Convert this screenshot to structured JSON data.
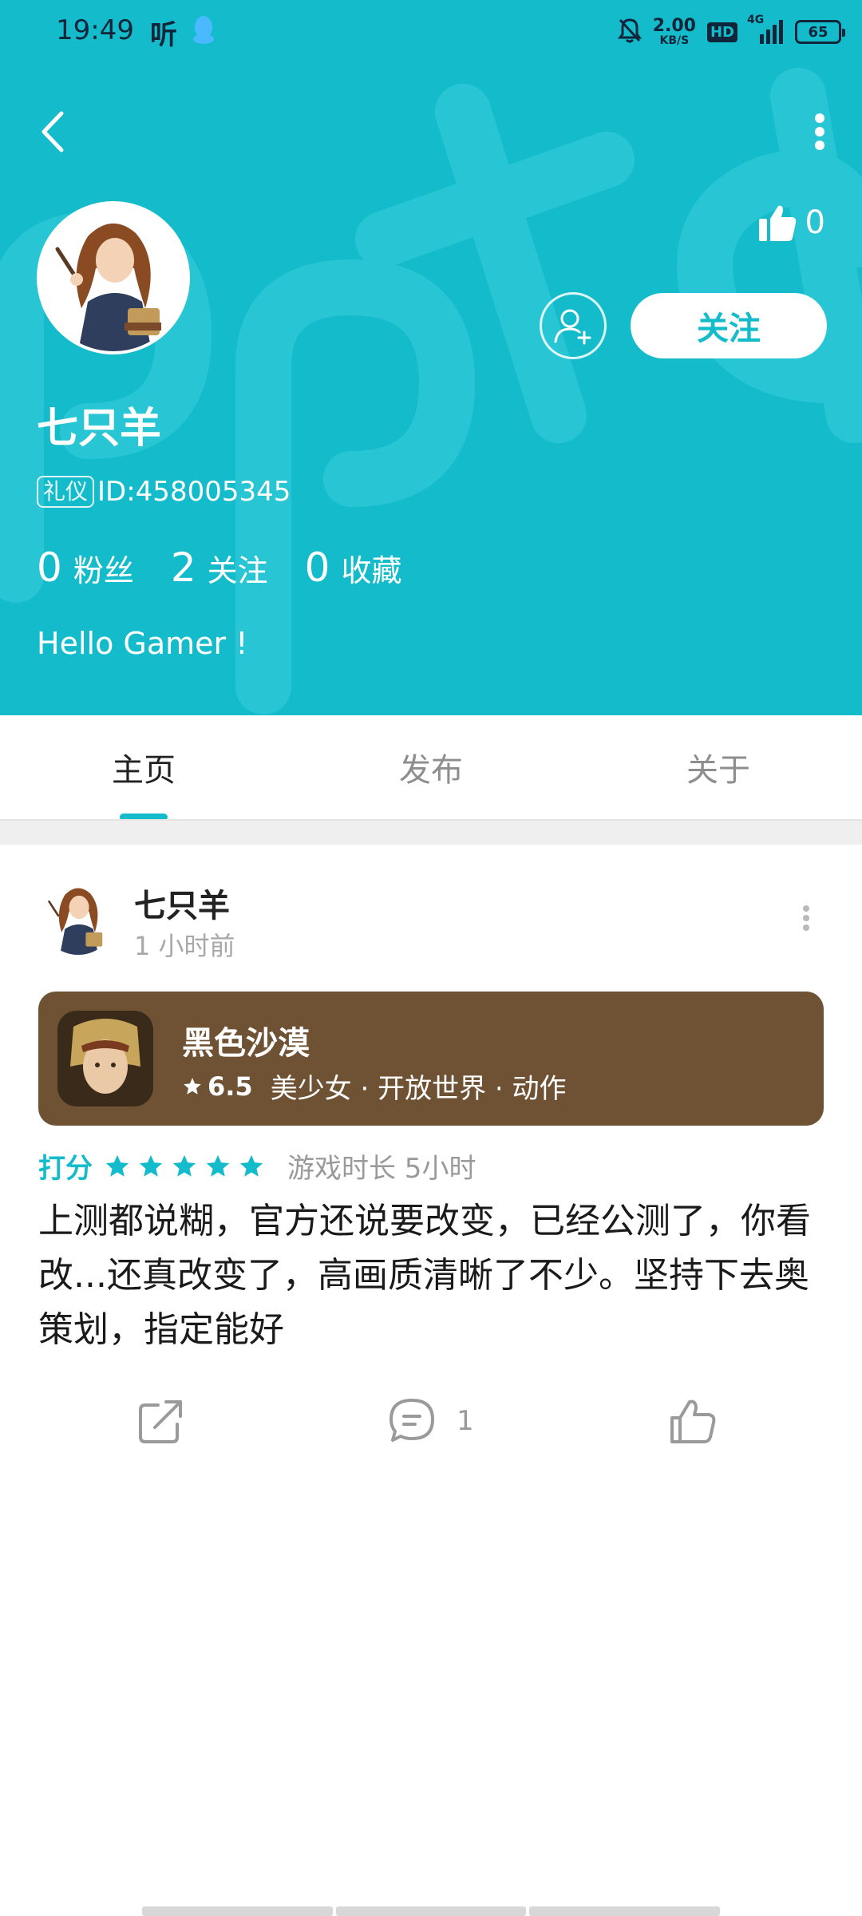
{
  "status_bar": {
    "time": "19:49",
    "listen_icon_text": "听",
    "speed_value": "2.00",
    "speed_unit": "KB/S",
    "hd_label": "HD",
    "network_label": "4G",
    "battery_level": "65"
  },
  "profile": {
    "likes": "0",
    "follow_label": "关注",
    "name": "七只羊",
    "badge": "礼仪",
    "id_text": "ID:458005345",
    "stats": [
      {
        "count": "0",
        "label": "粉丝"
      },
      {
        "count": "2",
        "label": "关注"
      },
      {
        "count": "0",
        "label": "收藏"
      }
    ],
    "bio": "Hello Gamer !"
  },
  "tabs": [
    "主页",
    "发布",
    "关于"
  ],
  "active_tab": "主页",
  "post": {
    "author": "七只羊",
    "time": "1 小时前",
    "game": {
      "name": "黑色沙漠",
      "rating": "6.5",
      "tags": "美少女 · 开放世界 · 动作"
    },
    "score_label": "打分",
    "star_count": 5,
    "playtime": "游戏时长 5小时",
    "review": "上测都说糊，官方还说要改变，已经公测了，你看改...还真改变了，高画质清晰了不少。坚持下去奥策划，指定能好",
    "comment_count": "1"
  },
  "colors": {
    "accent": "#14bccb",
    "game_card": "#6f5234",
    "text_primary": "#1a1a1a",
    "text_secondary": "#9a9a9a"
  },
  "icons": [
    "back-icon",
    "more-vertical-icon",
    "thumb-up-icon",
    "add-friend-icon",
    "star-icon",
    "share-icon",
    "comment-icon",
    "like-icon"
  ]
}
